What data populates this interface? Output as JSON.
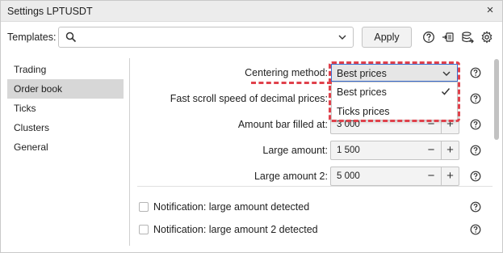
{
  "window": {
    "title": "Settings LPTUSDT",
    "close_glyph": "×"
  },
  "toolbar": {
    "templates_label": "Templates:",
    "search_value": "",
    "apply_label": "Apply",
    "icons": [
      "help-icon",
      "import-icon",
      "export-icon",
      "settings-icon"
    ]
  },
  "sidebar": {
    "items": [
      {
        "label": "Trading"
      },
      {
        "label": "Order book",
        "active": true
      },
      {
        "label": "Ticks"
      },
      {
        "label": "Clusters"
      },
      {
        "label": "General"
      }
    ]
  },
  "settings": {
    "centering_method": {
      "label": "Centering method:",
      "value": "Best prices",
      "options": [
        "Best prices",
        "Ticks prices"
      ],
      "selected_option": "Best prices"
    },
    "fast_scroll": {
      "label": "Fast scroll speed of decimal prices:"
    },
    "amount_bar_filled": {
      "label": "Amount bar filled at:",
      "value": "3 000"
    },
    "large_amount": {
      "label": "Large amount:",
      "value": "1 500"
    },
    "large_amount_2": {
      "label": "Large amount 2:",
      "value": "5 000"
    },
    "notification_large": {
      "label": "Notification: large amount detected",
      "checked": false
    },
    "notification_large_2": {
      "label": "Notification: large amount 2 detected",
      "checked": false
    }
  },
  "stepper": {
    "minus": "−",
    "plus": "+"
  },
  "colors": {
    "highlight": "#e0414b",
    "focus": "#3b6fd1",
    "active_nav": "#d7d7d7"
  }
}
